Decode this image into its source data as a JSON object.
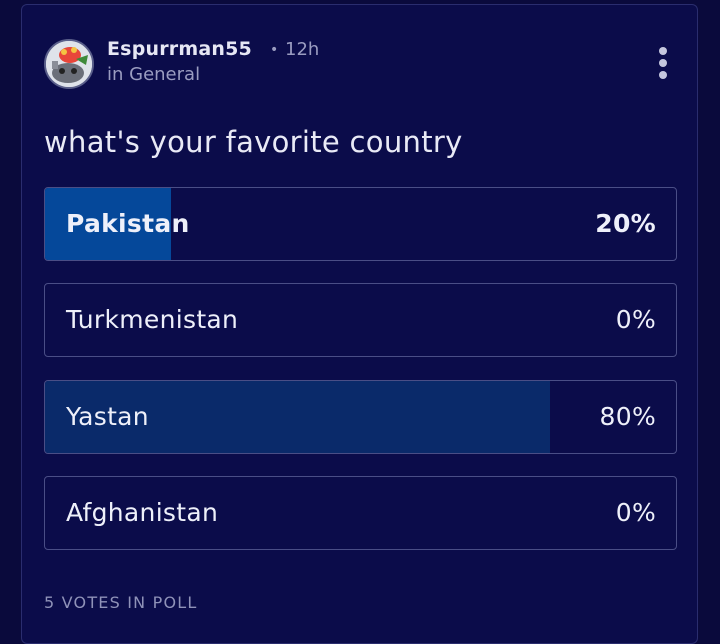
{
  "post": {
    "author": "Espurrman55",
    "separator": "•",
    "time": "12h",
    "community": "in General",
    "question": "what's your favorite country"
  },
  "poll": {
    "options": [
      {
        "label": "Pakistan",
        "percent_text": "20%",
        "percent": 20,
        "fill_color": "#05489a"
      },
      {
        "label": "Turkmenistan",
        "percent_text": "0%",
        "percent": 0,
        "fill_color": "#0a2a6a"
      },
      {
        "label": "Yastan",
        "percent_text": "80%",
        "percent": 80,
        "fill_color": "#0a2a6a"
      },
      {
        "label": "Afghanistan",
        "percent_text": "0%",
        "percent": 0,
        "fill_color": "#0a2a6a"
      }
    ],
    "votes_text": "5 VOTES IN POLL"
  },
  "icons": {
    "more": "vertical-ellipsis-icon",
    "avatar": "espurr-avatar"
  }
}
